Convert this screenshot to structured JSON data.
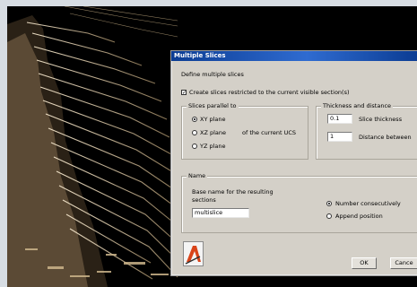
{
  "dialog": {
    "title": "Multiple Slices",
    "subtitle": "Define multiple slices",
    "restrict_checkbox": {
      "label": "Create slices restricted to the current visible section(s)",
      "checked": true
    },
    "slices_group": {
      "title": "Slices parallel to",
      "options": [
        "XY plane",
        "XZ plane",
        "YZ plane"
      ],
      "selected": "XY plane",
      "ucs_note": "of the current UCS"
    },
    "thickness_group": {
      "title": "Thickness and distance",
      "thickness_value": "0.1",
      "thickness_label": "Slice thickness",
      "distance_value": "1",
      "distance_label": "Distance between"
    },
    "name_group": {
      "title": "Name",
      "base_name_label": "Base name for the resulting sections",
      "base_name_value": "multislice",
      "numbering_options": [
        "Number consecutively",
        "Append position"
      ],
      "numbering_selected": "Number consecutively"
    },
    "ok_label": "OK",
    "cancel_label": "Cance"
  },
  "icons": {
    "viewport": "point-cloud-viewport",
    "logo": "application-logo-icon"
  }
}
